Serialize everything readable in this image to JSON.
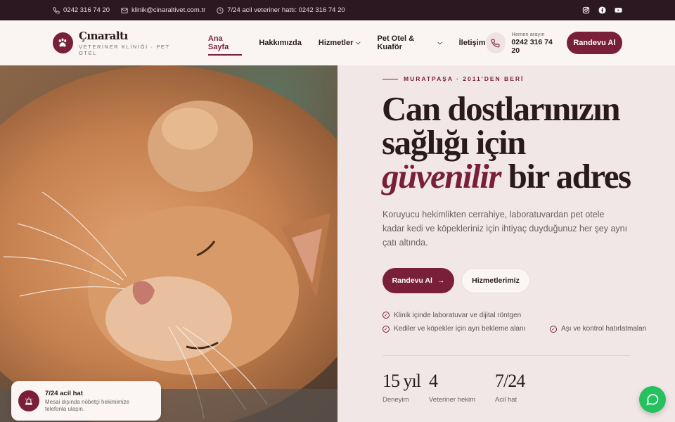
{
  "topbar": {
    "phone": "0242 316 74 20",
    "email": "klinik@cinaraltivet.com.tr",
    "emergency": "7/24 acil veteriner hattı: 0242 316 74 20",
    "social": [
      "instagram-icon",
      "facebook-icon",
      "youtube-icon"
    ]
  },
  "brand": {
    "name": "Çınaraltı",
    "tagline": "VETERİNER KLİNİĞİ · PET OTEL",
    "accent": "#7a1f3a"
  },
  "nav": {
    "items": [
      {
        "label": "Ana Sayfa",
        "active": true
      },
      {
        "label": "Hakkımızda"
      },
      {
        "label": "Hizmetler",
        "dropdown": true
      },
      {
        "label": "Pet Otel & Kuaför",
        "dropdown": true
      },
      {
        "label": "İletişim"
      }
    ]
  },
  "header": {
    "call_small": "Hemen arayın",
    "call_number": "0242 316 74 20",
    "cta": "Randevu Al"
  },
  "hero": {
    "eyebrow": "MURATPAŞA · 2011'DEN BERİ",
    "headline_1": "Can dostlarınızın",
    "headline_2": "sağlığı için",
    "headline_em": "güvenilir",
    "headline_3": " bir adres",
    "lead": "Koruyucu hekimlikten cerrahiye, laboratuvardan pet otele kadar kedi ve köpekleriniz için ihtiyaç duyduğunuz her şey aynı çatı altında.",
    "cta_primary": "Randevu Al",
    "cta_secondary": "Hizmetlerimiz",
    "features": [
      "Klinik içinde laboratuvar ve dijital röntgen",
      "Kediler ve köpekler için ayrı bekleme alanı",
      "Aşı ve kontrol hatırlatmaları"
    ],
    "stats": [
      {
        "value": "15 yıl",
        "label": "Deneyim"
      },
      {
        "value": "4",
        "label": "Veteriner hekim"
      },
      {
        "value": "7/24",
        "label": "Acil hat"
      }
    ]
  },
  "emergency_card": {
    "title": "7/24 acil hat",
    "text": "Mesai dışında nöbetçi hekimimize telefonla ulaşın."
  }
}
